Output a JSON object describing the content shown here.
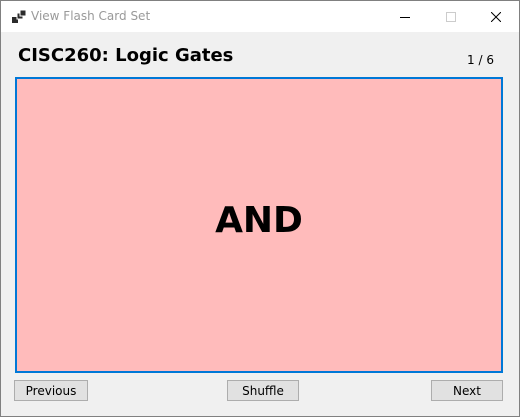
{
  "window": {
    "title": "View Flash Card Set",
    "app_icon": "cards-icon",
    "controls": [
      "minimize-icon",
      "maximize-icon",
      "close-icon"
    ]
  },
  "header": {
    "set_title": "CISC260: Logic Gates",
    "counter": "1 / 6"
  },
  "card": {
    "text": "AND",
    "background_color": "#ffbbbb",
    "border_color": "#0078d7"
  },
  "buttons": {
    "previous": "Previous",
    "shuffle": "Shuffle",
    "next": "Next"
  }
}
